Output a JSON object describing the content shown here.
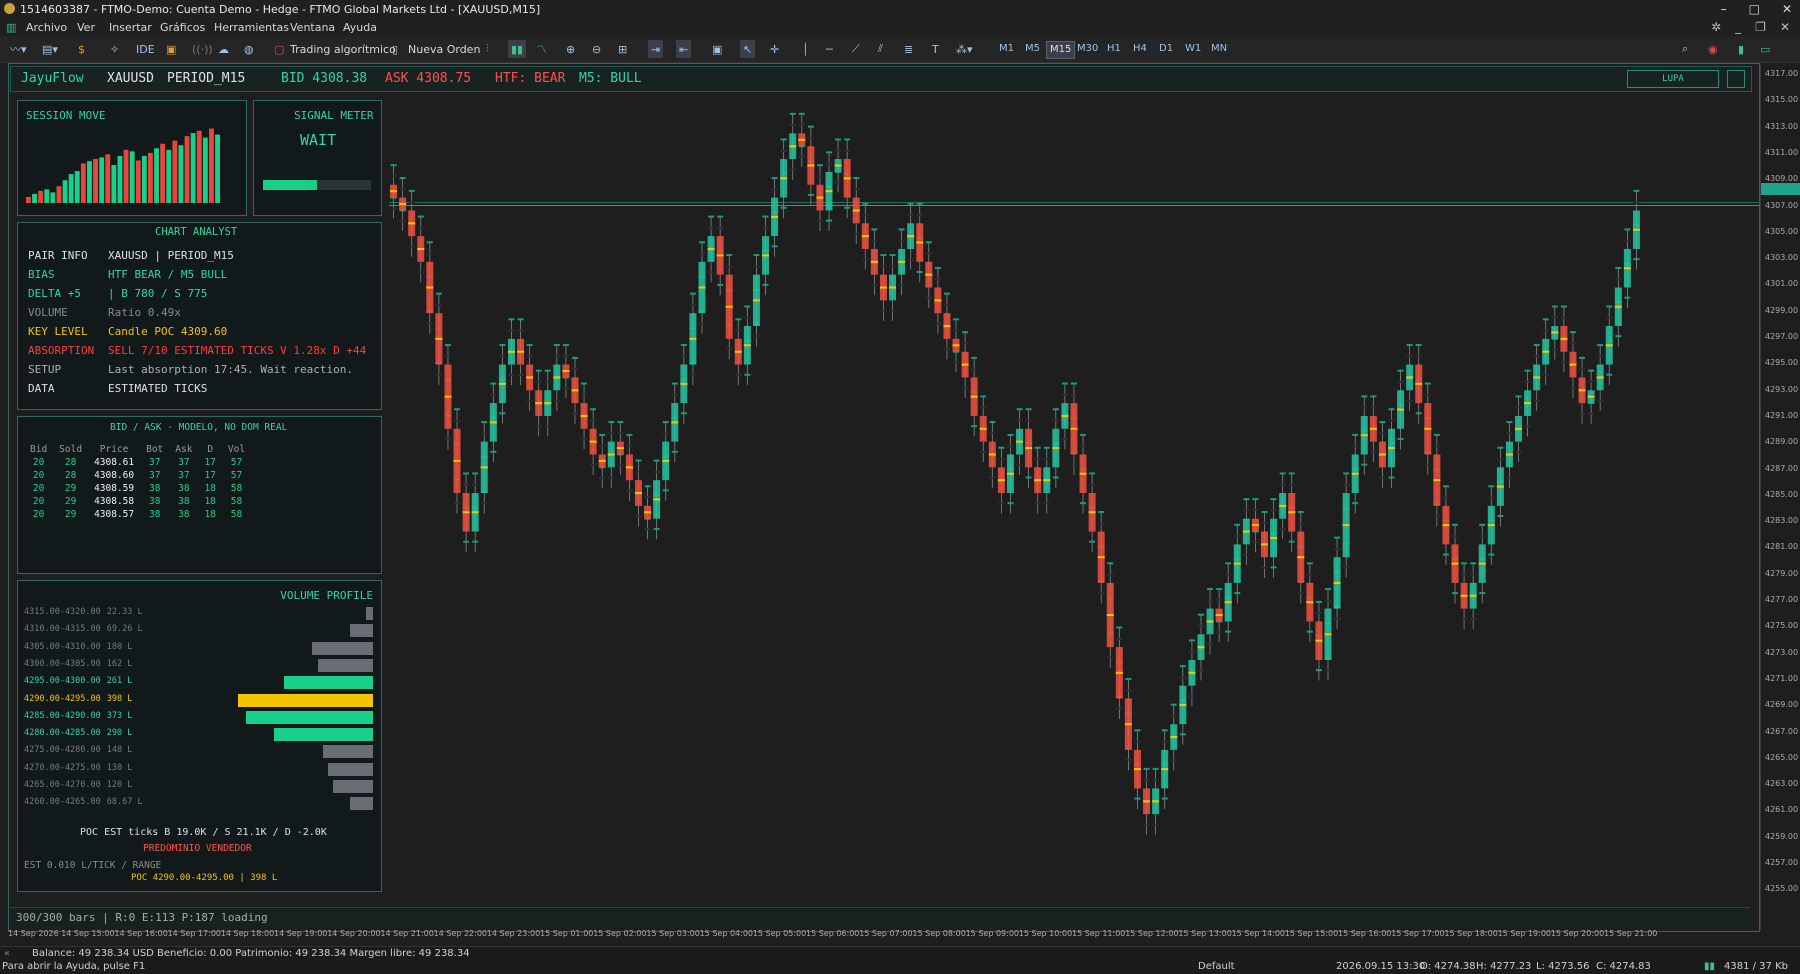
{
  "window": {
    "title": "1514603387 - FTMO-Demo: Cuenta Demo - Hedge - FTMO Global Markets Ltd - [XAUUSD,M15]"
  },
  "menu": [
    "Archivo",
    "Ver",
    "Insertar",
    "Gráficos",
    "Herramientas",
    "Ventana",
    "Ayuda"
  ],
  "toolbar": {
    "ide": "IDE",
    "algo_trading": "Trading algorítmico",
    "new_order": "Nueva Orden",
    "timeframes": [
      "M1",
      "M5",
      "M15",
      "M30",
      "H1",
      "H4",
      "D1",
      "W1",
      "MN"
    ],
    "active_timeframe": "M15"
  },
  "header": {
    "indicator": "JayuFlow",
    "symbol": "XAUUSD",
    "period": "PERIOD_M15",
    "bid": "BID 4308.38",
    "ask": "ASK 4308.75",
    "htf": "HTF: BEAR",
    "m5": "M5: BULL",
    "lupa": "LUPA"
  },
  "session_move": {
    "title": "SESSION MOVE",
    "bars": [
      {
        "v": 0.08,
        "c": "#e8463c"
      },
      {
        "v": 0.12,
        "c": "#19d08a"
      },
      {
        "v": 0.16,
        "c": "#e8463c"
      },
      {
        "v": 0.18,
        "c": "#19d08a"
      },
      {
        "v": 0.14,
        "c": "#19d08a"
      },
      {
        "v": 0.22,
        "c": "#e8463c"
      },
      {
        "v": 0.3,
        "c": "#19d08a"
      },
      {
        "v": 0.38,
        "c": "#19d08a"
      },
      {
        "v": 0.42,
        "c": "#19d08a"
      },
      {
        "v": 0.52,
        "c": "#e8463c"
      },
      {
        "v": 0.55,
        "c": "#19d08a"
      },
      {
        "v": 0.58,
        "c": "#e8463c"
      },
      {
        "v": 0.6,
        "c": "#19d08a"
      },
      {
        "v": 0.64,
        "c": "#e8463c"
      },
      {
        "v": 0.5,
        "c": "#19d08a"
      },
      {
        "v": 0.62,
        "c": "#19d08a"
      },
      {
        "v": 0.7,
        "c": "#e8463c"
      },
      {
        "v": 0.68,
        "c": "#19d08a"
      },
      {
        "v": 0.56,
        "c": "#e8463c"
      },
      {
        "v": 0.62,
        "c": "#19d08a"
      },
      {
        "v": 0.66,
        "c": "#e8463c"
      },
      {
        "v": 0.72,
        "c": "#19d08a"
      },
      {
        "v": 0.78,
        "c": "#e8463c"
      },
      {
        "v": 0.7,
        "c": "#19d08a"
      },
      {
        "v": 0.82,
        "c": "#e8463c"
      },
      {
        "v": 0.76,
        "c": "#19d08a"
      },
      {
        "v": 0.88,
        "c": "#e8463c"
      },
      {
        "v": 0.92,
        "c": "#19d08a"
      },
      {
        "v": 0.95,
        "c": "#e8463c"
      },
      {
        "v": 0.86,
        "c": "#19d08a"
      },
      {
        "v": 0.98,
        "c": "#e8463c"
      },
      {
        "v": 0.9,
        "c": "#19d08a"
      }
    ]
  },
  "signal": {
    "title": "SIGNAL METER",
    "state": "WAIT",
    "level": 0.5
  },
  "analyst": {
    "title": "CHART ANALYST",
    "rows": [
      {
        "k": "PAIR INFO",
        "v": "XAUUSD | PERIOD_M15",
        "kc": "#e0e0e0",
        "vc": "#e0e0e0"
      },
      {
        "k": "BIAS",
        "v": "HTF BEAR / M5 BULL",
        "kc": "#2fd6a6",
        "vc": "#2fd6a6"
      },
      {
        "k": "DELTA +5",
        "v": "| B 780 / S 775",
        "kc": "#2fd6a6",
        "vc": "#2fd6a6"
      },
      {
        "k": "VOLUME",
        "v": "Ratio 0.49x",
        "kc": "#8a8a8a",
        "vc": "#8a8a8a"
      },
      {
        "k": "KEY LEVEL",
        "v": "Candle POC 4309.60",
        "kc": "#f5c400",
        "vc": "#f5c400"
      },
      {
        "k": "ABSORPTION",
        "v": "SELL 7/10 ESTIMATED TICKS V 1.28x D +44",
        "kc": "#ff3b3b",
        "vc": "#ff3b3b"
      },
      {
        "k": "SETUP",
        "v": "Last absorption 17:45. Wait reaction.",
        "kc": "#b0b0b0",
        "vc": "#b0b0b0"
      },
      {
        "k": "DATA",
        "v": "ESTIMATED TICKS",
        "kc": "#e0e0e0",
        "vc": "#e0e0e0"
      }
    ]
  },
  "bidask": {
    "title": "BID / ASK - MODELO, NO DOM REAL",
    "headers": [
      "Bid",
      "Sold",
      "Price",
      "Bot",
      "Ask",
      "D",
      "Vol"
    ],
    "rows": [
      [
        "20",
        "28",
        "4308.61",
        "37",
        "37",
        "17",
        "57"
      ],
      [
        "20",
        "28",
        "4308.60",
        "37",
        "37",
        "17",
        "57"
      ],
      [
        "20",
        "29",
        "4308.59",
        "38",
        "38",
        "18",
        "58"
      ],
      [
        "20",
        "29",
        "4308.58",
        "38",
        "38",
        "18",
        "58"
      ],
      [
        "20",
        "29",
        "4308.57",
        "38",
        "38",
        "18",
        "58"
      ]
    ]
  },
  "volume_profile": {
    "title": "VOLUME PROFILE",
    "rows": [
      {
        "range": "4315.00-4320.00",
        "vol": "22.33 L",
        "w": 0.05,
        "c": "#6a6e74",
        "lc": "#7a7a7a"
      },
      {
        "range": "4310.00-4315.00",
        "vol": "69.26 L",
        "w": 0.17,
        "c": "#6a6e74",
        "lc": "#7a7a7a"
      },
      {
        "range": "4305.00-4310.00",
        "vol": "180 L",
        "w": 0.45,
        "c": "#6a6e74",
        "lc": "#7a7a7a"
      },
      {
        "range": "4300.00-4305.00",
        "vol": "162 L",
        "w": 0.41,
        "c": "#6a6e74",
        "lc": "#7a7a7a"
      },
      {
        "range": "4295.00-4300.00",
        "vol": "261 L",
        "w": 0.66,
        "c": "#19d08a",
        "lc": "#2fd6a6"
      },
      {
        "range": "4290.00-4295.00",
        "vol": "398 L",
        "w": 1.0,
        "c": "#f5c400",
        "lc": "#f5c400"
      },
      {
        "range": "4285.00-4290.00",
        "vol": "373 L",
        "w": 0.94,
        "c": "#19d08a",
        "lc": "#2fd6a6"
      },
      {
        "range": "4280.00-4285.00",
        "vol": "290 L",
        "w": 0.73,
        "c": "#19d08a",
        "lc": "#2fd6a6"
      },
      {
        "range": "4275.00-4280.00",
        "vol": "148 L",
        "w": 0.37,
        "c": "#6a6e74",
        "lc": "#7a7a7a"
      },
      {
        "range": "4270.00-4275.00",
        "vol": "130 L",
        "w": 0.33,
        "c": "#6a6e74",
        "lc": "#7a7a7a"
      },
      {
        "range": "4265.00-4270.00",
        "vol": "120 L",
        "w": 0.3,
        "c": "#6a6e74",
        "lc": "#7a7a7a"
      },
      {
        "range": "4260.00-4265.00",
        "vol": "68.67 L",
        "w": 0.17,
        "c": "#6a6e74",
        "lc": "#7a7a7a"
      }
    ],
    "poc_line": "POC EST ticks B 19.0K / S 21.1K / D -2.0K",
    "predominio": "PREDOMINIO VENDEDOR",
    "est": "EST 0.010 L/TICK / RANGE",
    "poc": "POC 4290.00-4295.00 | 398 L"
  },
  "bars_status": "300/300 bars | R:0 E:113 P:187 loading",
  "yaxis": [
    "4317.00",
    "4315.00",
    "4313.00",
    "4311.00",
    "4309.00",
    "4307.00",
    "4305.00",
    "4303.00",
    "4301.00",
    "4299.00",
    "4297.00",
    "4295.00",
    "4293.00",
    "4291.00",
    "4289.00",
    "4287.00",
    "4285.00",
    "4283.00",
    "4281.00",
    "4279.00",
    "4277.00",
    "4275.00",
    "4273.00",
    "4271.00",
    "4269.00",
    "4267.00",
    "4265.00",
    "4263.00",
    "4261.00",
    "4259.00",
    "4257.00",
    "4255.00"
  ],
  "xaxis": [
    "14 Sep 2026",
    "14 Sep 15:00",
    "14 Sep 16:00",
    "14 Sep 17:00",
    "14 Sep 18:00",
    "14 Sep 19:00",
    "14 Sep 20:00",
    "14 Sep 21:00",
    "14 Sep 22:00",
    "14 Sep 23:00",
    "15 Sep 01:00",
    "15 Sep 02:00",
    "15 Sep 03:00",
    "15 Sep 04:00",
    "15 Sep 05:00",
    "15 Sep 06:00",
    "15 Sep 07:00",
    "15 Sep 08:00",
    "15 Sep 09:00",
    "15 Sep 10:00",
    "15 Sep 11:00",
    "15 Sep 12:00",
    "15 Sep 13:00",
    "15 Sep 14:00",
    "15 Sep 15:00",
    "15 Sep 16:00",
    "15 Sep 17:00",
    "15 Sep 18:00",
    "15 Sep 19:00",
    "15 Sep 20:00",
    "15 Sep 21:00"
  ],
  "status": {
    "balance": "Balance: 49 238.34 USD  Beneficio: 0.00  Patrimonio: 49 238.34  Margen libre: 49 238.34",
    "help": "Para abrir la Ayuda, pulse F1",
    "profile": "Default",
    "time": "2026.09.15 13:30",
    "open": "O: 4274.38",
    "high": "H: 4277.23",
    "low": "L: 4273.56",
    "close": "C: 4274.83",
    "net": "4381 / 37 Kb"
  },
  "chart_data": {
    "type": "candlestick",
    "symbol": "XAUUSD",
    "timeframe": "M15",
    "ylim": [
      4254,
      4318
    ],
    "current_price": 4308.38,
    "closes": [
      4309,
      4308,
      4306,
      4304,
      4300,
      4296,
      4291,
      4286,
      4283,
      4286,
      4290,
      4293,
      4296,
      4298,
      4296,
      4294,
      4292,
      4294,
      4296,
      4295,
      4293,
      4291,
      4289,
      4288,
      4290,
      4289,
      4287,
      4285,
      4284,
      4287,
      4290,
      4293,
      4296,
      4300,
      4304,
      4306,
      4303,
      4298,
      4296,
      4299,
      4303,
      4306,
      4309,
      4312,
      4314,
      4313,
      4310,
      4308,
      4311,
      4312,
      4309,
      4307,
      4305,
      4303,
      4301,
      4303,
      4305,
      4307,
      4304,
      4302,
      4300,
      4298,
      4297,
      4295,
      4292,
      4290,
      4288,
      4286,
      4289,
      4291,
      4288,
      4286,
      4288,
      4291,
      4293,
      4289,
      4286,
      4283,
      4279,
      4274,
      4270,
      4266,
      4263,
      4261,
      4263,
      4266,
      4268,
      4271,
      4273,
      4275,
      4277,
      4276,
      4279,
      4282,
      4284,
      4283,
      4281,
      4284,
      4286,
      4283,
      4279,
      4276,
      4273,
      4277,
      4281,
      4286,
      4289,
      4292,
      4290,
      4288,
      4291,
      4294,
      4296,
      4293,
      4289,
      4285,
      4282,
      4279,
      4277,
      4279,
      4282,
      4285,
      4288,
      4290,
      4292,
      4294,
      4296,
      4298,
      4299,
      4297,
      4295,
      4293,
      4294,
      4296,
      4299,
      4302,
      4305,
      4308
    ]
  }
}
